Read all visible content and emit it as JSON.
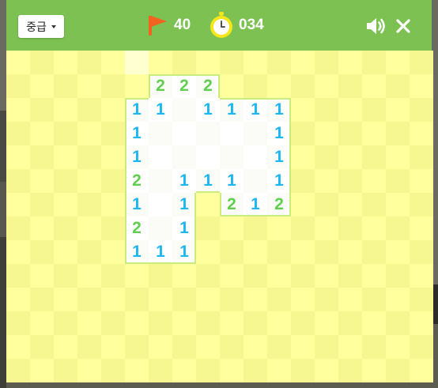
{
  "header": {
    "difficulty": "중급",
    "flags_remaining": "40",
    "timer": "034"
  },
  "colors": {
    "header_bg": "#7cc152",
    "board_covered_light": "#ffff9e",
    "board_covered_dark": "#f7f792",
    "board_open": "#ffffff",
    "number_1": "#1cb6f0",
    "number_2": "#5fcf4d",
    "flag": "#f26322",
    "timer_ring": "#f5e61b"
  },
  "icons": {
    "flag": "flag-icon",
    "timer": "stopwatch-icon",
    "sound": "speaker-icon",
    "close": "close-icon"
  },
  "board": {
    "columns": 18,
    "rows": 14,
    "cells": [
      [
        "c",
        "c",
        "c",
        "c",
        "c",
        "h",
        "c",
        "c",
        "c",
        "c",
        "c",
        "c",
        "c",
        "c",
        "c",
        "c",
        "c",
        "c"
      ],
      [
        "c",
        "c",
        "c",
        "c",
        "c",
        "c",
        "2",
        "2",
        "2",
        "c",
        "c",
        "c",
        "c",
        "c",
        "c",
        "c",
        "c",
        "c"
      ],
      [
        "c",
        "c",
        "c",
        "c",
        "c",
        "1",
        "1",
        "0",
        "1",
        "1",
        "1",
        "1",
        "c",
        "c",
        "c",
        "c",
        "c",
        "c"
      ],
      [
        "c",
        "c",
        "c",
        "c",
        "c",
        "1",
        "0",
        "0",
        "0",
        "0",
        "0",
        "1",
        "c",
        "c",
        "c",
        "c",
        "c",
        "c"
      ],
      [
        "c",
        "c",
        "c",
        "c",
        "c",
        "1",
        "0",
        "0",
        "0",
        "0",
        "0",
        "1",
        "c",
        "c",
        "c",
        "c",
        "c",
        "c"
      ],
      [
        "c",
        "c",
        "c",
        "c",
        "c",
        "2",
        "0",
        "1",
        "1",
        "1",
        "0",
        "1",
        "c",
        "c",
        "c",
        "c",
        "c",
        "c"
      ],
      [
        "c",
        "c",
        "c",
        "c",
        "c",
        "1",
        "0",
        "1",
        "c",
        "2",
        "1",
        "2",
        "c",
        "c",
        "c",
        "c",
        "c",
        "c"
      ],
      [
        "c",
        "c",
        "c",
        "c",
        "c",
        "2",
        "0",
        "1",
        "c",
        "c",
        "c",
        "c",
        "c",
        "c",
        "c",
        "c",
        "c",
        "c"
      ],
      [
        "c",
        "c",
        "c",
        "c",
        "c",
        "1",
        "1",
        "1",
        "c",
        "c",
        "c",
        "c",
        "c",
        "c",
        "c",
        "c",
        "c",
        "c"
      ],
      [
        "c",
        "c",
        "c",
        "c",
        "c",
        "c",
        "c",
        "c",
        "c",
        "c",
        "c",
        "c",
        "c",
        "c",
        "c",
        "c",
        "c",
        "c"
      ],
      [
        "c",
        "c",
        "c",
        "c",
        "c",
        "c",
        "c",
        "c",
        "c",
        "c",
        "c",
        "c",
        "c",
        "c",
        "c",
        "c",
        "c",
        "c"
      ],
      [
        "c",
        "c",
        "c",
        "c",
        "c",
        "c",
        "c",
        "c",
        "c",
        "c",
        "c",
        "c",
        "c",
        "c",
        "c",
        "c",
        "c",
        "c"
      ],
      [
        "c",
        "c",
        "c",
        "c",
        "c",
        "c",
        "c",
        "c",
        "c",
        "c",
        "c",
        "c",
        "c",
        "c",
        "c",
        "c",
        "c",
        "c"
      ],
      [
        "c",
        "c",
        "c",
        "c",
        "c",
        "c",
        "c",
        "c",
        "c",
        "c",
        "c",
        "c",
        "c",
        "c",
        "c",
        "c",
        "c",
        "c"
      ]
    ]
  }
}
